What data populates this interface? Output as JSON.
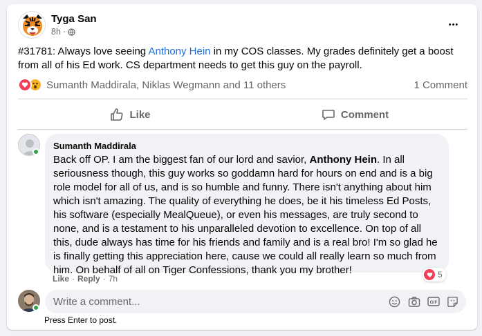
{
  "post": {
    "author": "Tyga San",
    "time": "8h",
    "dot": "·",
    "text_before": "#31781: Always love seeing ",
    "mention": "Anthony Hein",
    "text_after": " in my COS classes. My grades definitely get a boost from all of his Ed work. CS department needs to get this guy on the payroll.",
    "more_label": "•••"
  },
  "reactions": {
    "summary": "Sumanth Maddirala, Niklas Wegmann and 11 others",
    "comments": "1 Comment",
    "icons": [
      "love-icon",
      "wow-icon"
    ]
  },
  "actions": {
    "like": "Like",
    "comment": "Comment"
  },
  "comment": {
    "author": "Sumanth Maddirala",
    "text_a": "Back off OP. I am the biggest fan of our lord and savior, ",
    "bold": "Anthony Hein",
    "text_b": ". In all seriousness though, this guy works so goddamn hard for hours on end and is a big role model for all of us, and is so humble and funny. There isn't anything about him which isn't amazing. The quality of everything he does, be it his timeless Ed Posts, his software (especially MealQueue), or even his messages, are truly second to none, and is a testament to his unparalleled devotion to excellence. On top of all this, dude always has time for his friends and family and is a real bro! I'm so glad he is finally getting this appreciation here, cause we could all really learn so much from him. On behalf of all on Tiger Confessions, thank you my brother!",
    "like": "Like",
    "sep": "·",
    "reply": "Reply",
    "time": "7h",
    "reaction_count": "5"
  },
  "composer": {
    "placeholder": "Write a comment...",
    "hint": "Press Enter to post."
  },
  "colors": {
    "link": "#216fdb",
    "love": "#f33e58",
    "wow": "#f7b125",
    "online": "#31a24c",
    "muted": "#65676b"
  }
}
